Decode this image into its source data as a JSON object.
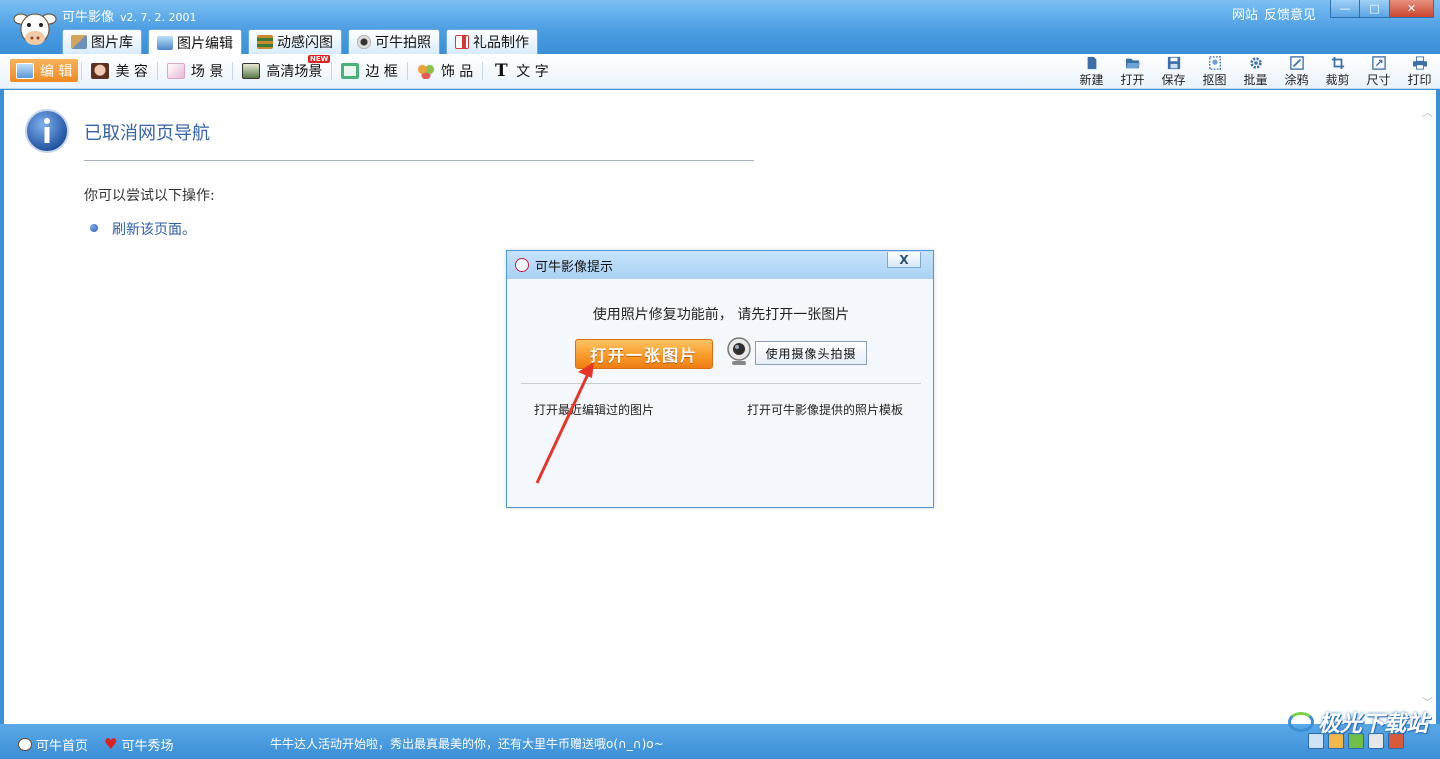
{
  "app": {
    "title": "可牛影像",
    "version": "v2. 7. 2. 2001",
    "links": [
      "网站",
      "反馈意见"
    ]
  },
  "window_buttons": {
    "minimize": "—",
    "maximize": "□",
    "close": "✕"
  },
  "main_tabs": [
    {
      "label": "图片库",
      "icon": "gallery-icon",
      "color": "#6b8fb8"
    },
    {
      "label": "图片编辑",
      "icon": "image-edit-icon",
      "color": "#4a87c9",
      "active": true
    },
    {
      "label": "动感闪图",
      "icon": "film-icon",
      "color": "#c98a2e"
    },
    {
      "label": "可牛拍照",
      "icon": "webcam-icon",
      "color": "#666666"
    },
    {
      "label": "礼品制作",
      "icon": "gift-icon",
      "color": "#d23a3a"
    }
  ],
  "sub_tools": [
    {
      "label": "编 辑",
      "icon": "edit-icon",
      "color": "#5b9ad8",
      "active": true
    },
    {
      "label": "美 容",
      "icon": "face-icon",
      "color": "#c98574"
    },
    {
      "label": "场 景",
      "icon": "scene-icon",
      "color": "#e7b6d8"
    },
    {
      "label": "高清场景",
      "icon": "hd-scene-icon",
      "color": "#5a7a4a",
      "badge": "NEW"
    },
    {
      "label": "边 框",
      "icon": "frame-icon",
      "color": "#4bb07a"
    },
    {
      "label": "饰 品",
      "icon": "accessory-icon",
      "color": "#e6a23c"
    },
    {
      "label": "文 字",
      "icon": "text-icon",
      "color": "#333333"
    }
  ],
  "right_tools": [
    {
      "label": "新建",
      "icon": "new-file-icon"
    },
    {
      "label": "打开",
      "icon": "folder-open-icon"
    },
    {
      "label": "保存",
      "icon": "save-icon"
    },
    {
      "label": "抠图",
      "icon": "cutout-icon"
    },
    {
      "label": "批量",
      "icon": "batch-icon"
    },
    {
      "label": "涂鸦",
      "icon": "doodle-icon"
    },
    {
      "label": "裁剪",
      "icon": "crop-icon"
    },
    {
      "label": "尺寸",
      "icon": "resize-icon"
    },
    {
      "label": "打印",
      "icon": "print-icon"
    }
  ],
  "page": {
    "title": "已取消网页导航",
    "hint": "你可以尝试以下操作:",
    "refresh_link": "刷新该页面。"
  },
  "dialog": {
    "title": "可牛影像提示",
    "close": "X",
    "message": "使用照片修复功能前， 请先打开一张图片",
    "open_button": "打开一张图片",
    "camera_button": "使用摄像头拍摄",
    "recent_link": "打开最近编辑过的图片",
    "template_link": "打开可牛影像提供的照片模板"
  },
  "status": {
    "home": "可牛首页",
    "show": "可牛秀场",
    "message": "牛牛达人活动开始啦，秀出最真最美的你，还有大里牛币赠送哦o(∩_∩)o~"
  },
  "watermark": "极光下载站",
  "colors": {
    "accent_blue": "#3b8fd6",
    "orange_button": "#f99a2a",
    "link_blue": "#2c5ea8",
    "annotation_red": "#e8352a"
  }
}
